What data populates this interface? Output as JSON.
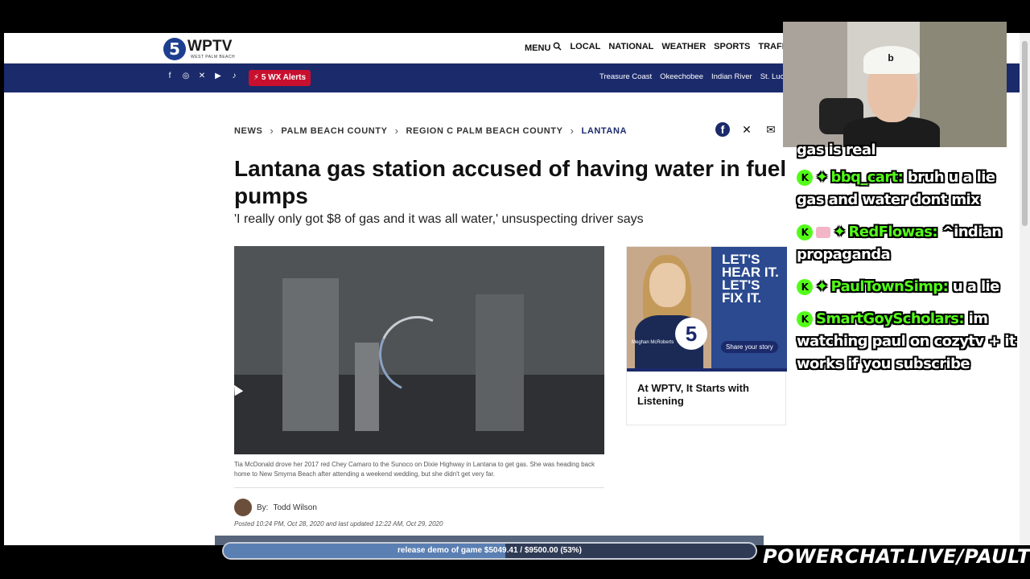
{
  "site": {
    "logo_number": "5",
    "logo_text": "WPTV",
    "logo_sub": "WEST PALM BEACH"
  },
  "nav": {
    "menu_label": "MENU",
    "links": [
      "LOCAL",
      "NATIONAL",
      "WEATHER",
      "SPORTS",
      "TRAFFI"
    ]
  },
  "subnav": {
    "social_icons": [
      "facebook-icon",
      "instagram-icon",
      "x-icon",
      "youtube-icon",
      "tiktok-icon"
    ],
    "wx_alert_label": "5  WX Alerts",
    "regions": [
      "Treasure Coast",
      "Okeechobee",
      "Indian River",
      "St. Luci"
    ]
  },
  "breadcrumb": [
    "NEWS",
    "PALM BEACH COUNTY",
    "REGION C PALM BEACH COUNTY",
    "LANTANA"
  ],
  "article": {
    "headline": "Lantana gas station accused of having water in fuel pumps",
    "subhead": "'I really only got $8 of gas and it was all water,' unsuspecting driver says",
    "caption": "Tia McDonald drove her 2017 red Chey Camaro to the Sunoco on Dixie Highway in Lantana to get gas. She was heading back home to New Smyrna Beach after attending a weekend wedding, but she didn't get very far.",
    "by_label": "By:",
    "author": "Todd Wilson",
    "posted": "Posted 10:24 PM, Oct 28, 2020 and last updated 12:22 AM, Oct 29, 2020"
  },
  "ad": {
    "slogan": "LET'S HEAR IT. LET'S FIX IT.",
    "person_name": "Meghan McRoberts",
    "logo": "5",
    "logo_text": "WPTV",
    "share_button": "Share your story",
    "title": "At WPTV, It Starts with Listening"
  },
  "chat": {
    "first_line": "gas is real",
    "messages": [
      {
        "user": "bbq_cart:",
        "text": "bruh u a lie gas and water dont mix",
        "pink": false,
        "gem": true
      },
      {
        "user": "RedFlowas:",
        "text": "^indian propaganda",
        "pink": true,
        "gem": true
      },
      {
        "user": "PaulTownSimp:",
        "text": "u a lie",
        "pink": false,
        "gem": true
      },
      {
        "user": "SmartGoyScholars:",
        "text": "im watching paul on cozytv + it works if you subscribe",
        "pink": false,
        "gem": false
      }
    ]
  },
  "goal": {
    "label": "release demo of game $5049.41 / $9500.00 (53%)",
    "progress": 0.53
  },
  "overlay": {
    "url": "POWERCHAT.LIVE/PAULTOWN"
  },
  "colors": {
    "brand_navy": "#1b2a6b",
    "alert_red": "#c8102e",
    "chat_green": "#53fc18"
  }
}
